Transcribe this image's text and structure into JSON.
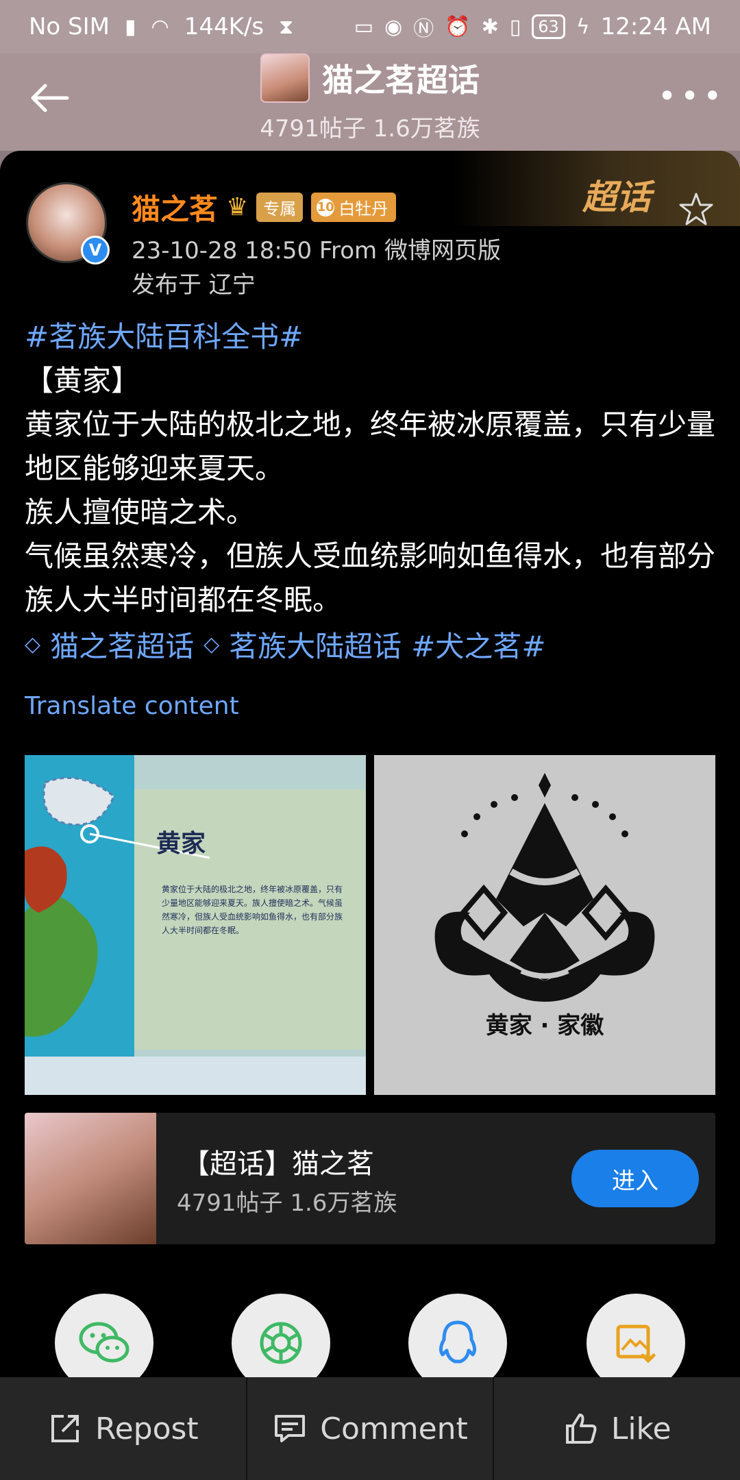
{
  "status_bar": {
    "carrier": "No SIM",
    "speed": "144K/s",
    "battery": "63",
    "time": "12:24 AM"
  },
  "header": {
    "title": "猫之茗超话",
    "subtitle": "4791帖子 1.6万茗族",
    "more_label": "•••"
  },
  "post": {
    "chaohua_label": "超话",
    "author": {
      "name": "猫之茗",
      "exclusive_badge": "专属",
      "level_num": "10",
      "level_badge": "白牡丹",
      "verified_mark": "V"
    },
    "meta": "23-10-28 18:50   From 微博网页版",
    "location": "发布于 辽宁",
    "topic_tag": "#茗族大陆百科全书#",
    "lines": [
      "【黄家】",
      "黄家位于大陆的极北之地，终年被冰原覆盖，只有少量地区能够迎来夏天。",
      "族人擅使暗之术。",
      "气候虽然寒冷，但族人受血统影响如鱼得水，也有部分族人大半时间都在冬眠。"
    ],
    "links": {
      "chaohua1": "猫之茗超话",
      "chaohua2": "茗族大陆超话",
      "tag": "#犬之茗#"
    },
    "translate": "Translate content",
    "image1": {
      "title": "黄家",
      "text": "黄家位于大陆的极北之地，终年被冰原覆盖，只有少量地区能够迎来夏天。族人擅使暗之术。气候虽然寒冷，但族人受血统影响如鱼得水，也有部分族人大半时间都在冬眠。"
    },
    "image2": {
      "caption": "黄家 · 家徽"
    }
  },
  "topic_card": {
    "name": "【超话】猫之茗",
    "stats": "4791帖子 1.6万茗族",
    "enter_label": "进入"
  },
  "share_targets": [
    "wechat-icon",
    "moments-icon",
    "qq-icon",
    "save-image-icon"
  ],
  "bottom_bar": {
    "repost": "Repost",
    "comment": "Comment",
    "like": "Like"
  },
  "colors": {
    "author_name": "#ff8a1e",
    "link": "#6fa8ff",
    "enter_button": "#1a7fe8"
  }
}
